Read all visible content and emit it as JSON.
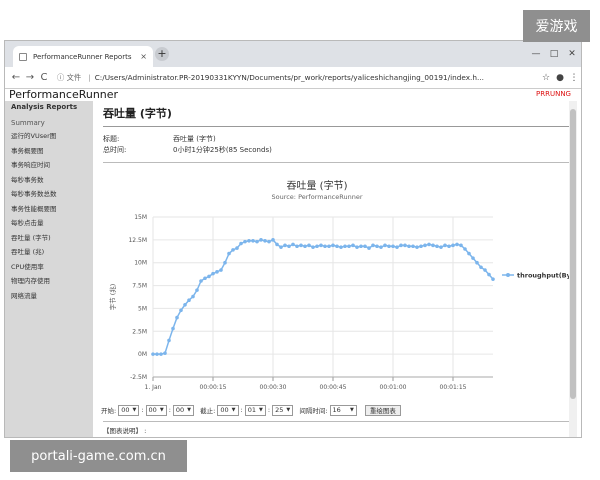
{
  "watermarks": {
    "top": "爱游戏",
    "bottom": "portali-game.com.cn"
  },
  "browser": {
    "tab_title": "PerformanceRunner Reports",
    "tab_close": "×",
    "new_tab": "+",
    "window_controls": [
      "—",
      "□",
      "✕"
    ],
    "nav": {
      "back": "←",
      "forward": "→",
      "reload": "C"
    },
    "address": {
      "info": "ⓘ 文件",
      "url": "C:/Users/Administrator.PR-20190331KYYN/Documents/pr_work/reports/yaliceshichangjing_00191/index.h..."
    },
    "right_icons": [
      "☆",
      "●",
      "⋮"
    ]
  },
  "app": {
    "brand": "PerformanceRunner",
    "brand_right": "PRRUNNG"
  },
  "sidebar": {
    "title": "Analysis Reports",
    "section": "Summary",
    "items": [
      {
        "label": "运行的VUser图"
      },
      {
        "label": "事务概要图"
      },
      {
        "label": "事务响应时间"
      },
      {
        "label": "每秒事务数"
      },
      {
        "label": "每秒事务数总数"
      },
      {
        "label": "事务性能概要图"
      },
      {
        "label": "每秒点击量"
      },
      {
        "label": "吞吐量 (字节)"
      },
      {
        "label": "吞吐量 (兆)"
      },
      {
        "label": "CPU使用率"
      },
      {
        "label": "物理内存使用"
      },
      {
        "label": "网络流量"
      }
    ]
  },
  "main": {
    "title": "吞吐量 (字节)",
    "meta": [
      {
        "k": "标题:",
        "v": "吞吐量 (字节)"
      },
      {
        "k": "总时间:",
        "v": "0小时1分钟25秒(85 Seconds)"
      }
    ],
    "controls": {
      "start_label": "开始:",
      "start": [
        "00",
        "00",
        "00"
      ],
      "end_label": "截止:",
      "end": [
        "00",
        "01",
        "25"
      ],
      "interval_label": "间隔时间:",
      "interval": "16",
      "redraw": "重绘图表",
      "legend_note": "【图表说明】 :"
    }
  },
  "chart_data": {
    "type": "line",
    "title": "吞吐量 (字节)",
    "subtitle": "Source: PerformanceRunner",
    "ylabel": "字节 (兆)",
    "xlabel": "",
    "y_ticks": [
      "15M",
      "12.5M",
      "10M",
      "7.5M",
      "5M",
      "2.5M",
      "0M",
      "-2.5M"
    ],
    "x_ticks": [
      "1. Jan",
      "00:00:15",
      "00:00:30",
      "00:00:45",
      "00:01:00",
      "00:01:15"
    ],
    "ylim": [
      -2.5,
      15
    ],
    "xlim": [
      0,
      85
    ],
    "grid": true,
    "legend_position": "right",
    "series": [
      {
        "name": "throughput(Bytes",
        "color": "#7cb5ec",
        "x": [
          0,
          1,
          2,
          3,
          4,
          5,
          6,
          7,
          8,
          9,
          10,
          11,
          12,
          13,
          14,
          15,
          16,
          17,
          18,
          19,
          20,
          21,
          22,
          23,
          24,
          25,
          26,
          27,
          28,
          29,
          30,
          31,
          32,
          33,
          34,
          35,
          36,
          37,
          38,
          39,
          40,
          41,
          42,
          43,
          44,
          45,
          46,
          47,
          48,
          49,
          50,
          51,
          52,
          53,
          54,
          55,
          56,
          57,
          58,
          59,
          60,
          61,
          62,
          63,
          64,
          65,
          66,
          67,
          68,
          69,
          70,
          71,
          72,
          73,
          74,
          75,
          76,
          77,
          78,
          79,
          80,
          81,
          82,
          83,
          84,
          85
        ],
        "values": [
          0,
          0,
          0,
          0.1,
          1.5,
          2.8,
          4.0,
          4.8,
          5.4,
          5.9,
          6.3,
          7.0,
          8.0,
          8.3,
          8.5,
          8.8,
          9.0,
          9.2,
          10.0,
          11.0,
          11.4,
          11.6,
          12.1,
          12.3,
          12.4,
          12.4,
          12.3,
          12.5,
          12.4,
          12.3,
          12.5,
          12.0,
          11.7,
          11.9,
          11.8,
          12.0,
          11.8,
          11.9,
          11.8,
          11.9,
          11.7,
          11.8,
          11.9,
          11.8,
          11.8,
          11.9,
          11.8,
          11.7,
          11.8,
          11.8,
          11.9,
          11.7,
          11.8,
          11.8,
          11.6,
          11.9,
          11.8,
          11.7,
          11.9,
          11.8,
          11.8,
          11.7,
          11.9,
          11.9,
          11.8,
          11.8,
          11.7,
          11.8,
          11.9,
          12.0,
          11.9,
          11.8,
          11.7,
          11.9,
          11.8,
          11.9,
          12.0,
          11.9,
          11.5,
          11.0,
          10.5,
          10.0,
          9.5,
          9.2,
          8.7,
          8.2
        ]
      }
    ]
  }
}
